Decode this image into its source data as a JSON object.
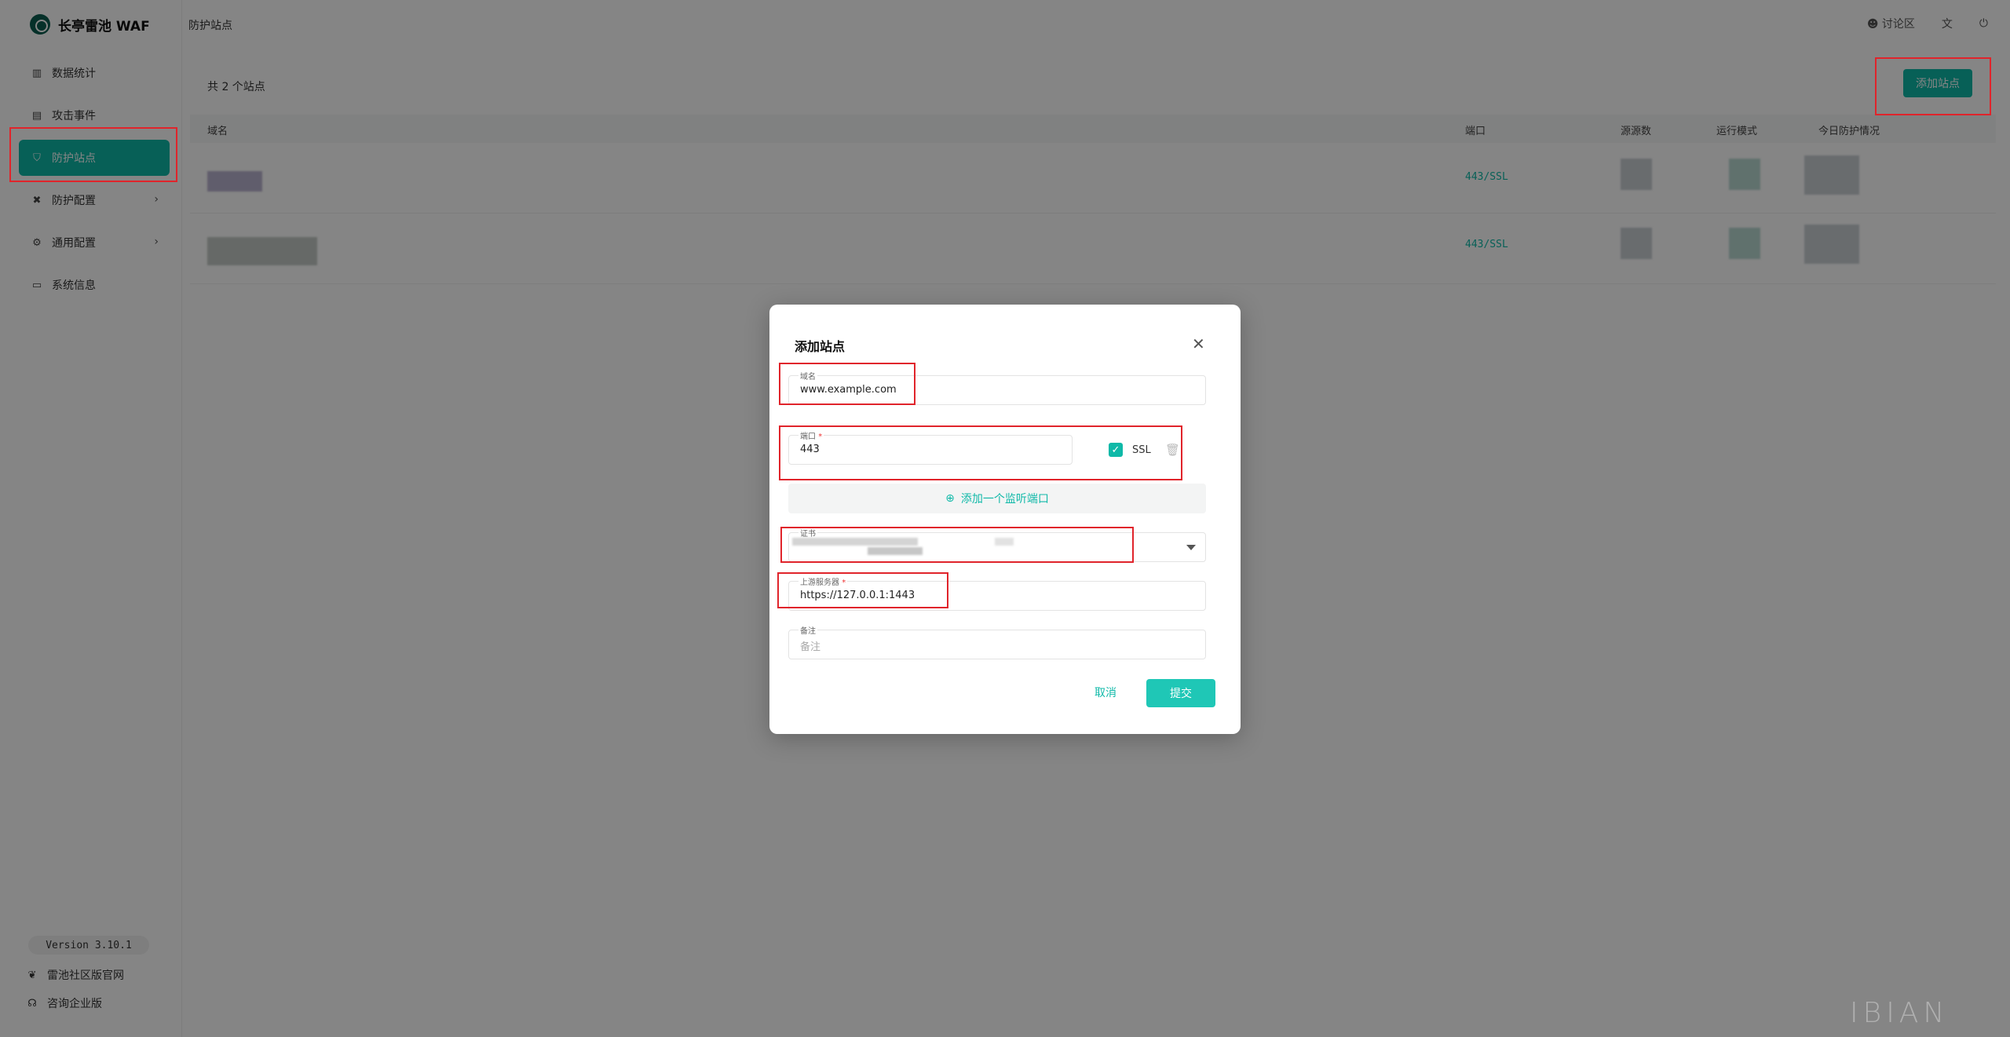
{
  "app": {
    "name": "长亭雷池 WAF"
  },
  "sidebar": {
    "items": [
      {
        "label": "数据统计",
        "icon": "bar-chart-icon"
      },
      {
        "label": "攻击事件",
        "icon": "document-icon"
      },
      {
        "label": "防护站点",
        "icon": "shield-icon",
        "active": true
      },
      {
        "label": "防护配置",
        "icon": "tools-icon",
        "has_children": true
      },
      {
        "label": "通用配置",
        "icon": "gear-icon",
        "has_children": true
      },
      {
        "label": "系统信息",
        "icon": "monitor-icon"
      }
    ],
    "version": "Version 3.10.1",
    "footer": [
      {
        "label": "雷池社区版官网",
        "icon": "leaf-icon"
      },
      {
        "label": "咨询企业版",
        "icon": "headset-icon"
      }
    ]
  },
  "topbar": {
    "breadcrumb": "防护站点",
    "forum": "讨论区",
    "icons": [
      "translate-icon",
      "logout-icon"
    ]
  },
  "main": {
    "count_text": "共 2 个站点",
    "add_button": "添加站点",
    "columns": [
      "域名",
      "端口",
      "源源数",
      "运行模式",
      "今日防护情况"
    ],
    "rows": [
      {
        "port": "443/SSL"
      },
      {
        "port": "443/SSL"
      }
    ]
  },
  "dialog": {
    "title": "添加站点",
    "domain": {
      "label": "域名",
      "value": "www.example.com"
    },
    "port": {
      "label": "端口",
      "required": "*",
      "value": "443",
      "ssl_label": "SSL",
      "ssl_checked": true
    },
    "add_port": "添加一个监听端口",
    "cert": {
      "label": "证书"
    },
    "upstream": {
      "label": "上游服务器",
      "required": "*",
      "value": "https://127.0.0.1:1443"
    },
    "remark": {
      "label": "备注",
      "placeholder": "备注"
    },
    "cancel": "取消",
    "submit": "提交"
  },
  "watermark": "IBIAN",
  "colors": {
    "accent": "#0fb9a8",
    "highlight": "#e0242b"
  }
}
